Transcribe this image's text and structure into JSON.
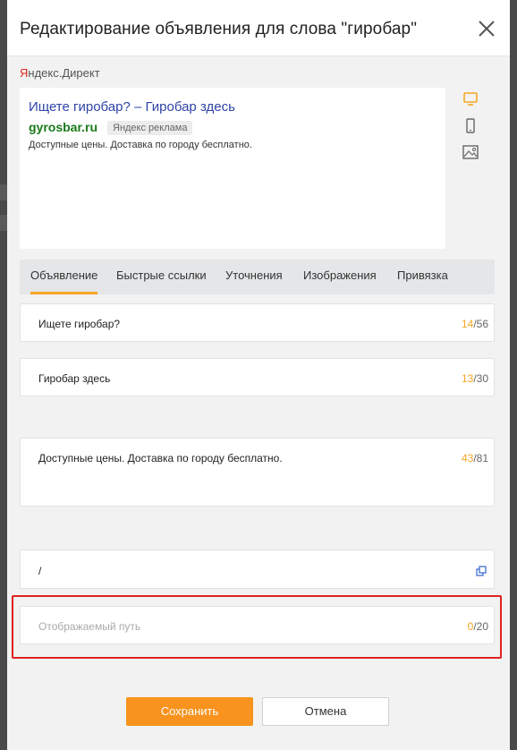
{
  "modal": {
    "title": "Редактирование объявления для слова \"гиробар\""
  },
  "provider": {
    "brand_first_letter": "Я",
    "brand_rest": "ндекс.Директ"
  },
  "preview": {
    "title": "Ищете гиробар? – Гиробар здесь",
    "domain": "gyrosbar.ru",
    "label": "Яндекс реклама",
    "description": "Доступные цены. Доставка по городу бесплатно."
  },
  "device_icons": [
    "desktop-icon",
    "mobile-icon",
    "image-icon"
  ],
  "tabs": [
    {
      "label": "Объявление",
      "active": true
    },
    {
      "label": "Быстрые ссылки",
      "active": false
    },
    {
      "label": "Уточнения",
      "active": false
    },
    {
      "label": "Изображения",
      "active": false
    },
    {
      "label": "Привязка",
      "active": false
    }
  ],
  "fields": {
    "title1": {
      "value": "Ищете гиробар?",
      "count": "14",
      "max": "/56"
    },
    "title2": {
      "value": "Гиробар здесь",
      "count": "13",
      "max": "/30"
    },
    "text": {
      "value": "Доступные цены. Доставка по городу бесплатно.",
      "count": "43",
      "max": "/81"
    },
    "url": {
      "value": "/"
    },
    "display_path": {
      "placeholder": "Отображаемый путь",
      "count": "0",
      "max": "/20"
    }
  },
  "buttons": {
    "save": "Сохранить",
    "cancel": "Отмена"
  },
  "colors": {
    "accent": "#f7931e",
    "counter_current": "#f5a623",
    "highlight": "#e02020",
    "ad_title": "#2f44a8",
    "ad_domain": "#1a7a1a"
  }
}
